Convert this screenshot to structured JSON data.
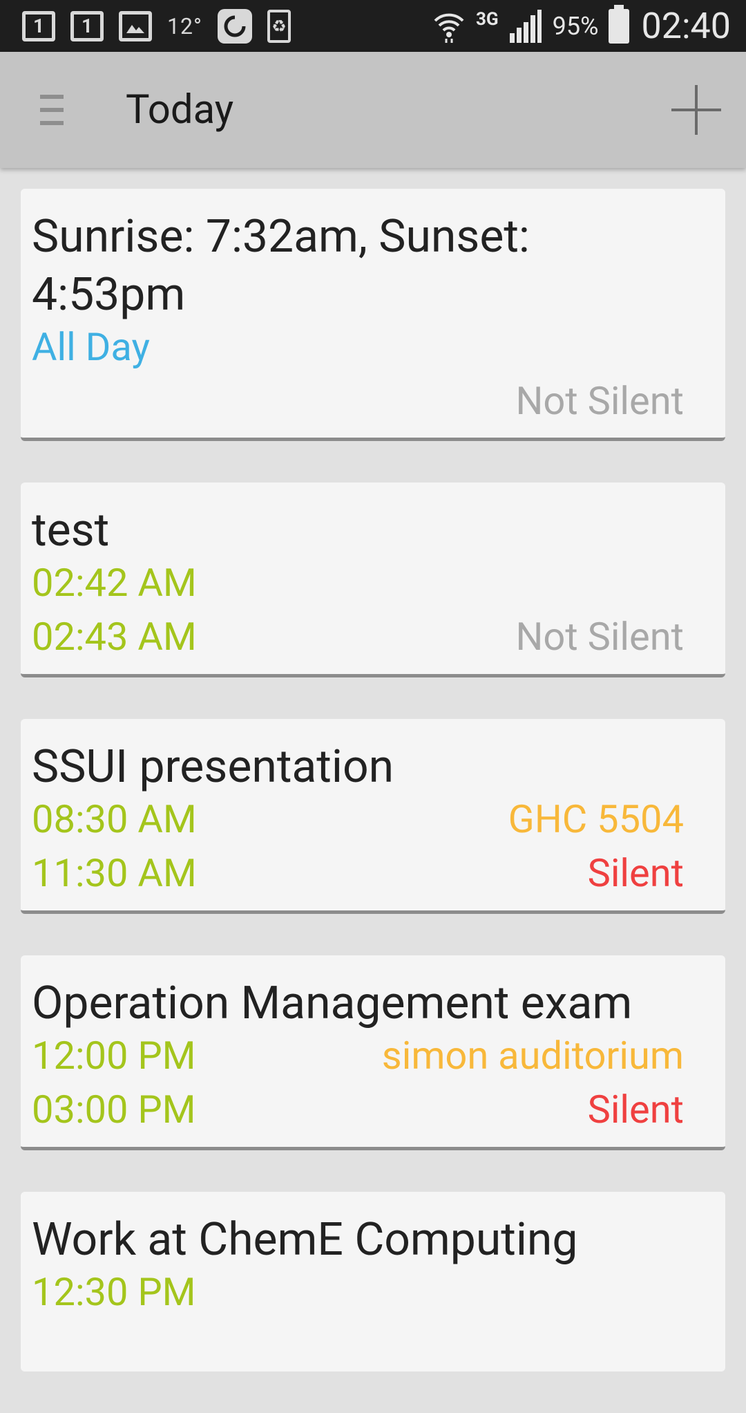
{
  "status_bar": {
    "icon_1": "1",
    "icon_2": "1",
    "temp": "12°",
    "network": "3G",
    "battery": "95%",
    "time": "02:40"
  },
  "app_bar": {
    "title": "Today"
  },
  "events": [
    {
      "title": "Sunrise: 7:32am, Sunset: 4:53pm",
      "time_label": "All Day",
      "status": "Not Silent"
    },
    {
      "title": "test",
      "start": "02:42 AM",
      "end": "02:43 AM",
      "status": "Not Silent"
    },
    {
      "title": "SSUI presentation",
      "start": "08:30 AM",
      "end": "11:30 AM",
      "location": "GHC 5504",
      "status": "Silent"
    },
    {
      "title": "Operation Management exam",
      "start": "12:00 PM",
      "end": "03:00 PM",
      "location": "simon auditorium",
      "status": "Silent"
    },
    {
      "title": "Work at ChemE Computing",
      "start": "12:30 PM"
    }
  ],
  "colors": {
    "time": "#a4c51c",
    "all_day": "#3fb0e3",
    "location": "#f8b83a",
    "silent": "#ef4040",
    "not_silent": "#a8a8a8"
  }
}
